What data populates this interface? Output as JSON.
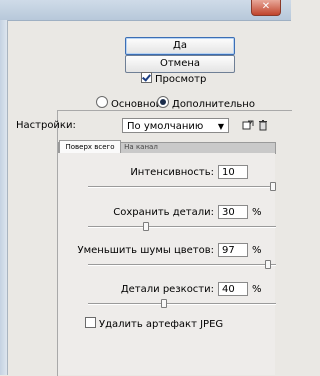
{
  "window": {
    "title_text": ""
  },
  "buttons": {
    "ok_label": "Да",
    "cancel_label": "Отмена"
  },
  "preview": {
    "label": "Просмотр",
    "checked": true
  },
  "mode": {
    "basic_label": "Основной",
    "advanced_label": "Дополнительно",
    "selected": "advanced"
  },
  "settings": {
    "label": "Настройки:",
    "value": "По умолчанию"
  },
  "tabs": {
    "active": "Поверх всего",
    "inactive": "На канал"
  },
  "params": [
    {
      "label": "Интенсивность:",
      "value": "10",
      "unit": "",
      "slider": 1.0
    },
    {
      "label": "Сохранить детали:",
      "value": "30",
      "unit": "%",
      "slider": 0.3
    },
    {
      "label": "Уменьшить шумы цветов:",
      "value": "97",
      "unit": "%",
      "slider": 0.97
    },
    {
      "label": "Детали резкости:",
      "value": "40",
      "unit": "%",
      "slider": 0.4
    }
  ],
  "jpeg": {
    "label": "Удалить артефакт JPEG",
    "checked": false
  }
}
